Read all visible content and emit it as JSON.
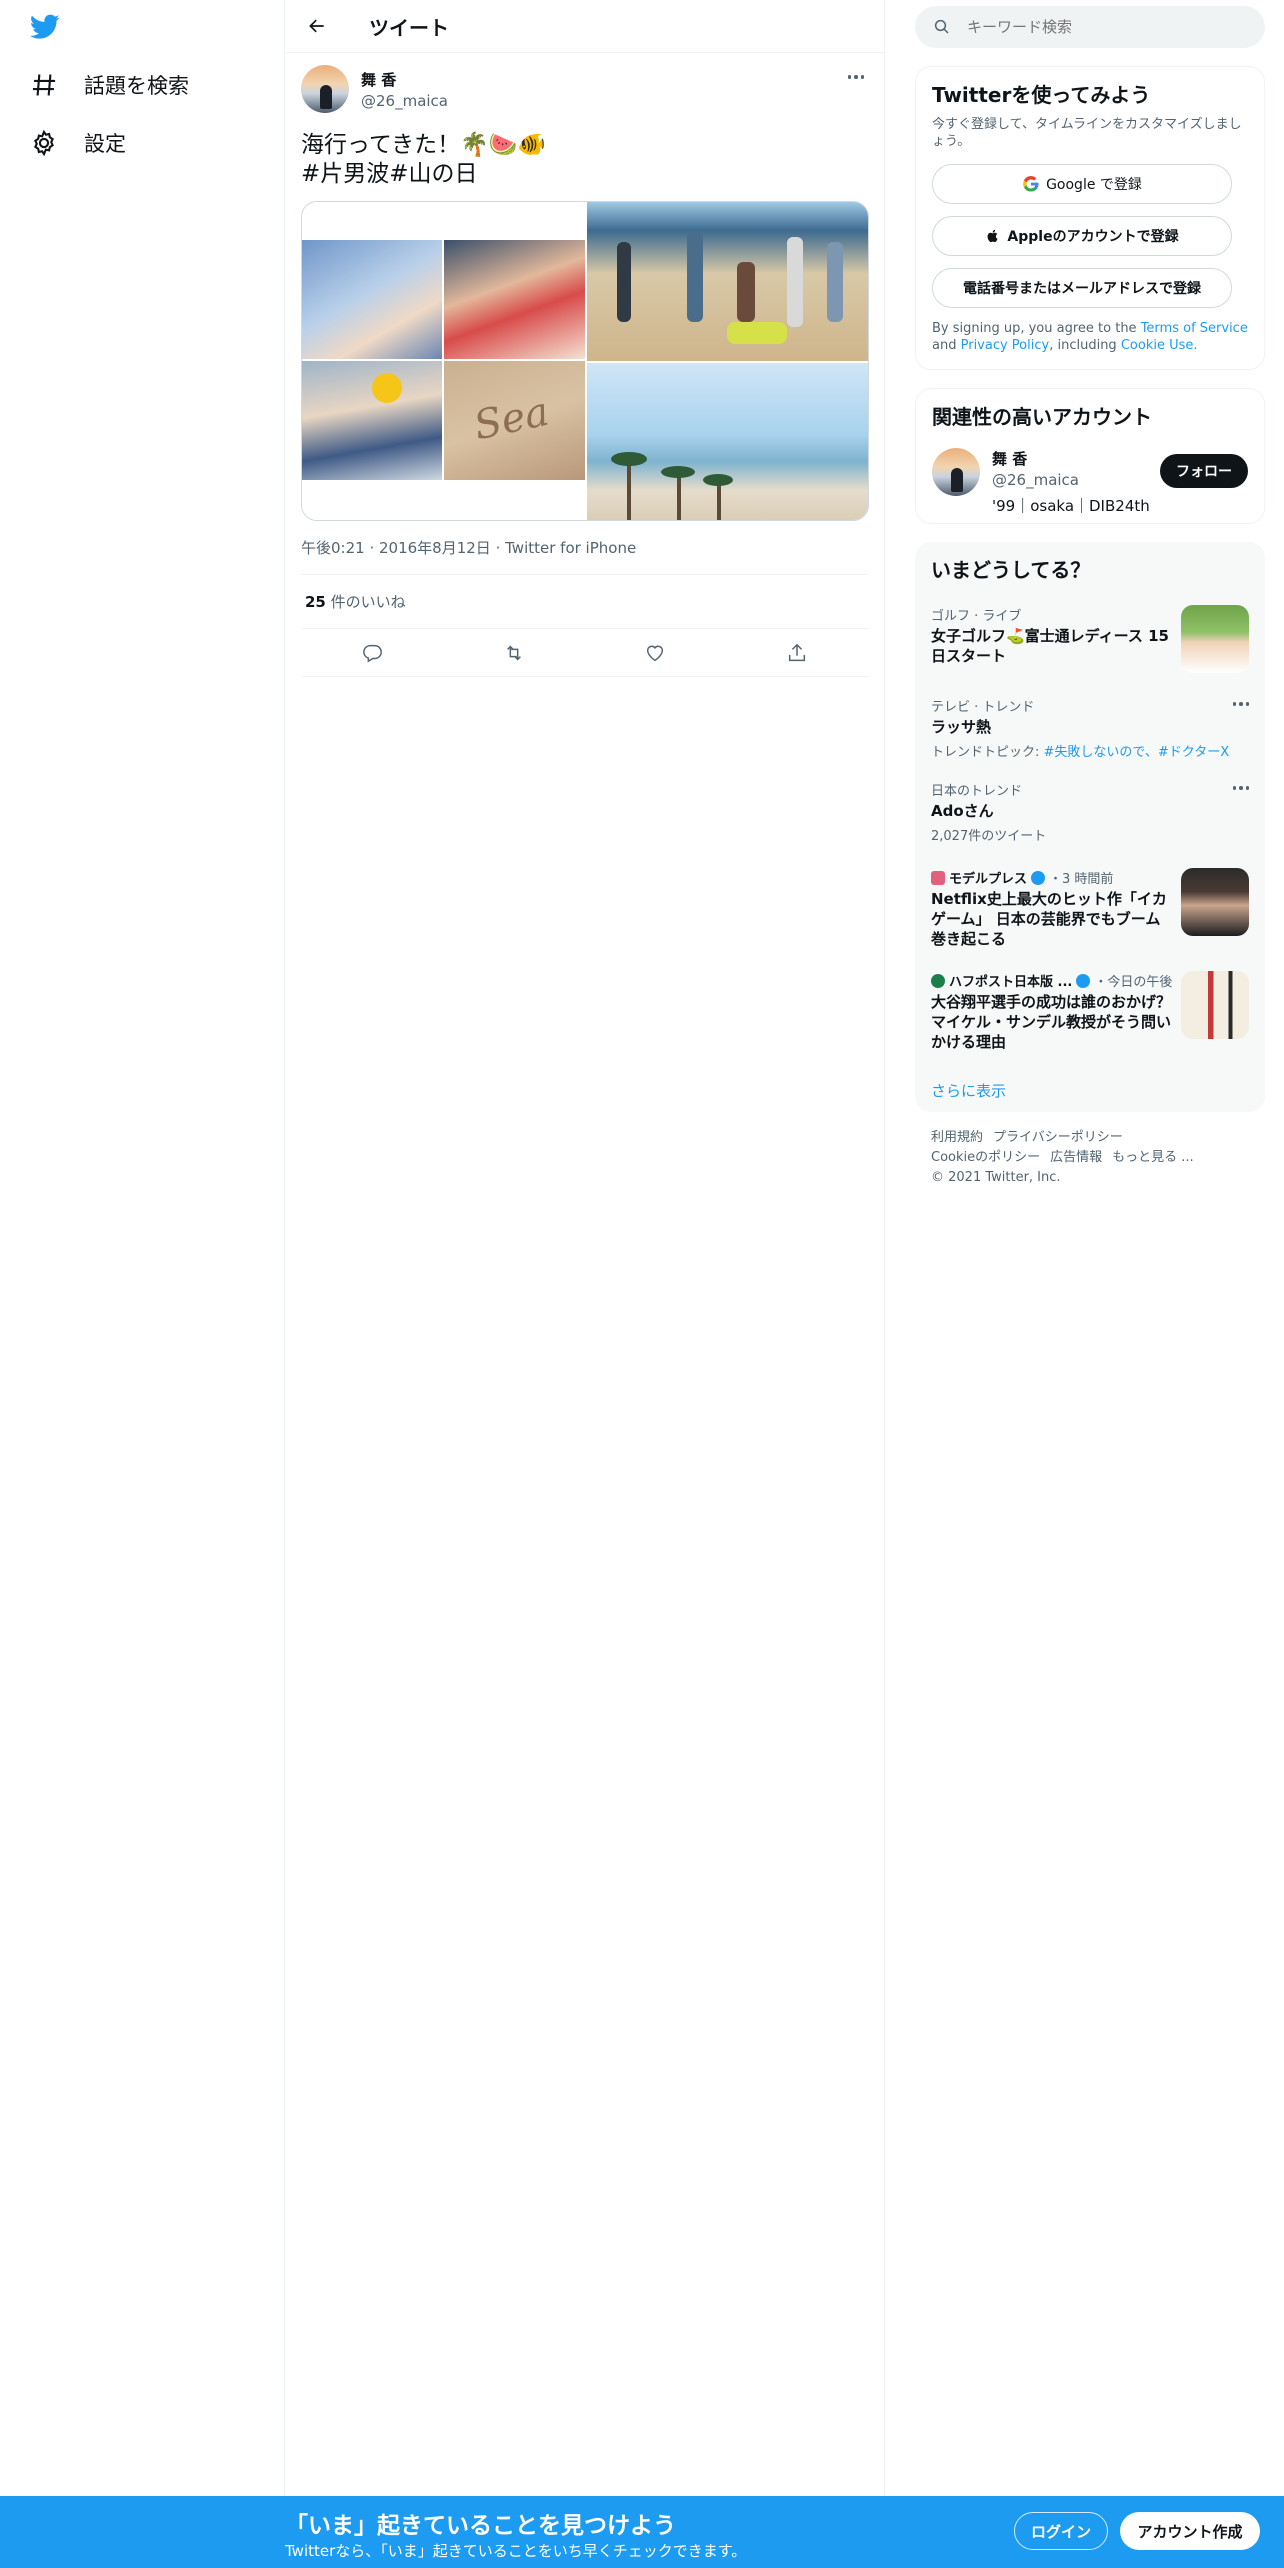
{
  "nav": {
    "explore_label": "話題を検索",
    "settings_label": "設定"
  },
  "main": {
    "title": "ツイート"
  },
  "tweet": {
    "author_name": "舞 香",
    "author_handle": "@26_maica",
    "text_line1": "海行ってきた！🌴🍉🐠",
    "hashtag1": "#片男波",
    "hashtag2": "#山の日",
    "image_text": "Sea",
    "time": "午後0:21",
    "date": "2016年8月12日",
    "client": "Twitter for iPhone",
    "like_count": "25",
    "like_label": "件のいいね"
  },
  "search": {
    "placeholder": "キーワード検索"
  },
  "signup_panel": {
    "title": "Twitterを使ってみよう",
    "subtitle": "今すぐ登録して、タイムラインをカスタマイズしましょう。",
    "google_label": "Google で登録",
    "apple_label": "Appleのアカウントで登録",
    "phone_label": "電話番号またはメールアドレスで登録",
    "legal_prefix": "By signing up, you agree to the",
    "terms": "Terms of Service",
    "and": "and",
    "privacy": "Privacy Policy",
    "including": ", including",
    "cookie": "Cookie Use."
  },
  "relevant": {
    "title": "関連性の高いアカウント",
    "name": "舞 香",
    "handle": "@26_maica",
    "bio": "'99｜osaka｜DIB24th",
    "follow_label": "フォロー"
  },
  "trends": {
    "title": "いまどうしてる？",
    "items": [
      {
        "category": "ゴルフ · ライブ",
        "title": "女子ゴルフ⛳富士通レディース 15日スタート"
      },
      {
        "category": "テレビ · トレンド",
        "title": "ラッサ熱",
        "detail_prefix": "トレンドトピック: ",
        "detail_tags": "#失敗しないので、#ドクターX"
      },
      {
        "category": "日本のトレンド",
        "title": "Adoさん",
        "detail": "2,027件のツイート"
      },
      {
        "source": "モデルプレス",
        "time": "・3 時間前",
        "title": "Netflix史上最大のヒット作「イカゲーム」 日本の芸能界でもブーム巻き起こる"
      },
      {
        "source": "ハフポスト日本版 ...",
        "time": "・今日の午後",
        "title": "大谷翔平選手の成功は誰のおかげ？ マイケル・サンデル教授がそう問いかける理由"
      }
    ],
    "show_more": "さらに表示"
  },
  "footer": {
    "links": [
      "利用規約",
      "プライバシーポリシー",
      "Cookieのポリシー",
      "広告情報",
      "もっと見る ..."
    ],
    "copyright": "© 2021 Twitter, Inc."
  },
  "banner": {
    "title": "「いま」起きていることを見つけよう",
    "subtitle": "Twitterなら、「いま」起きていることをいち早くチェックできます。",
    "login_label": "ログイン",
    "signup_label": "アカウント作成"
  },
  "colors": {
    "accent": "#1d9bf0",
    "text": "#0f1419",
    "muted": "#536471",
    "border": "#eff3f4"
  }
}
